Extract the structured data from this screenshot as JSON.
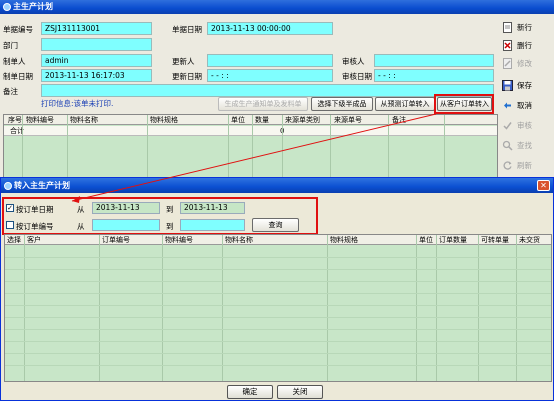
{
  "main_window": {
    "title": "主生产计划"
  },
  "form": {
    "doc_no_label": "单据编号",
    "doc_no": "ZSJ131113001",
    "doc_date_label": "单据日期",
    "doc_date": "2013-11-13 00:00:00",
    "dept_label": "部门",
    "dept": "",
    "creator_label": "制单人",
    "creator": "admin",
    "updater_label": "更新人",
    "updater": "",
    "reviewer_label": "审核人",
    "reviewer": "",
    "create_date_label": "制单日期",
    "create_date": "2013-11-13 16:17:03",
    "update_date_label": "更新日期",
    "update_date": "- -    : :",
    "review_date_label": "审核日期",
    "review_date": "- -    : :",
    "remark_label": "备注",
    "remark": ""
  },
  "print_info": "打印信息:该单未打印.",
  "action_buttons": {
    "gen_notice": "生成生产通知单及发料单",
    "select_lower": "选择下级半成品",
    "from_forecast": "从预测订单转入",
    "from_customer": "从客户订单转入"
  },
  "toolbar": [
    {
      "label": "新行",
      "icon": "new-icon",
      "disabled": false
    },
    {
      "label": "删行",
      "icon": "delete-row-icon",
      "disabled": false
    },
    {
      "label": "修改",
      "icon": "edit-icon",
      "disabled": true
    },
    {
      "label": "保存",
      "icon": "save-icon",
      "disabled": false
    },
    {
      "label": "取消",
      "icon": "cancel-icon",
      "disabled": false
    },
    {
      "label": "审核",
      "icon": "approve-icon",
      "disabled": true
    },
    {
      "label": "查找",
      "icon": "find-icon",
      "disabled": true
    },
    {
      "label": "刷新",
      "icon": "refresh-icon",
      "disabled": true
    }
  ],
  "grid1": {
    "headers": [
      "序号",
      "物料编号",
      "物料名称",
      "物料规格",
      "单位",
      "数量",
      "来源单类别",
      "来源单号",
      "备注"
    ],
    "total_label": "合计",
    "total_qty": "0"
  },
  "dialog": {
    "title": "转入主生产计划",
    "by_order_date_label": "按订单日期",
    "by_order_date_checked": true,
    "from_label": "从",
    "to_label": "到",
    "date_from": "2013-11-13",
    "date_to": "2013-11-13",
    "by_order_no_label": "按订单编号",
    "by_order_no_checked": false,
    "order_from": "",
    "order_to": "",
    "query_button": "查询",
    "grid_headers": [
      "选择",
      "客户",
      "订单编号",
      "物料编号",
      "物料名称",
      "物料规格",
      "单位",
      "订单数量",
      "可转单量",
      "未交货"
    ],
    "ok_button": "确定",
    "close_button": "关闭"
  }
}
